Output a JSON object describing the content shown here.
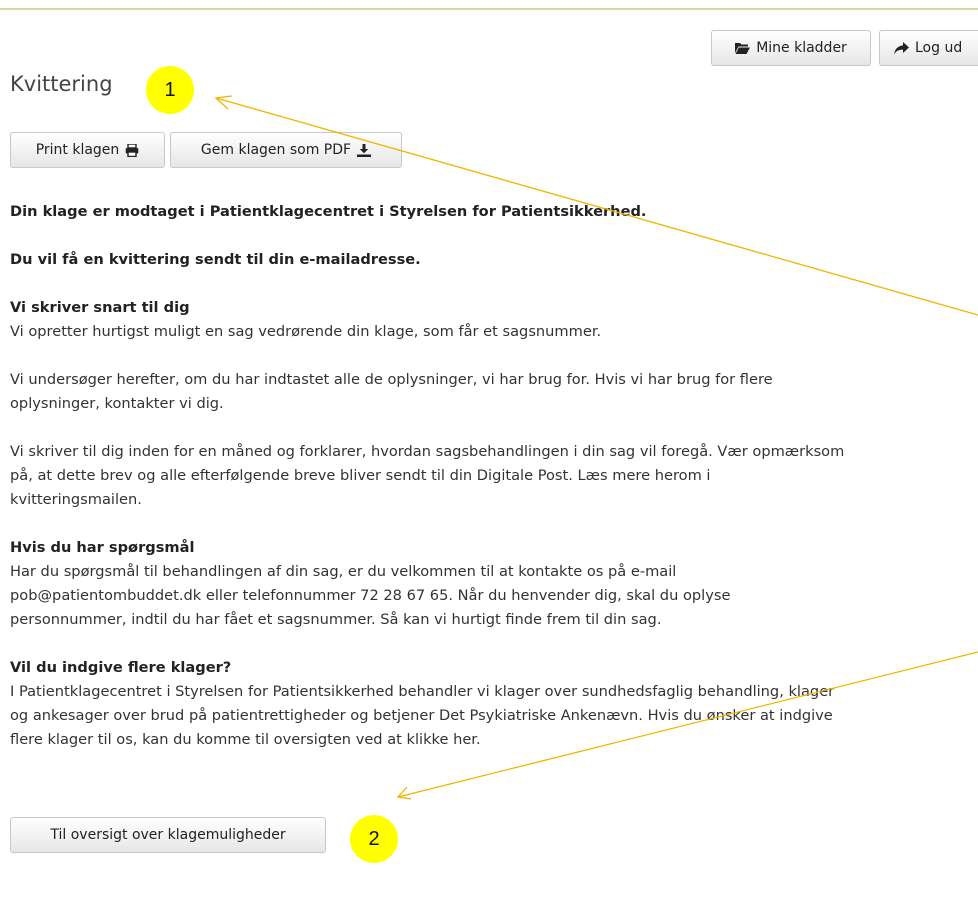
{
  "header": {
    "mine_kladder_label": "Mine kladder",
    "log_ud_label": "Log ud"
  },
  "page": {
    "title": "Kvittering"
  },
  "actions": {
    "print_label": "Print klagen",
    "pdf_label": "Gem klagen som PDF"
  },
  "content": {
    "line_received": "Din klage er modtaget i Patientklagecentret i Styrelsen for Patientsikkerhed.",
    "line_receipt": "Du vil få en kvittering sendt til din e-mailadresse.",
    "section1_heading": "Vi skriver snart til dig",
    "section1_p1": "Vi opretter hurtigst muligt en sag vedrørende din klage, som får et sagsnummer.",
    "section1_p2_l1": "Vi undersøger herefter, om du har indtastet alle de oplysninger, vi har brug for. Hvis vi har brug for flere",
    "section1_p2_l2": "oplysninger, kontakter vi dig.",
    "section1_p3_l1": "Vi skriver til dig inden for en måned og forklarer, hvordan sagsbehandlingen i din sag vil foregå. Vær opmærksom",
    "section1_p3_l2": "på, at dette brev og alle efterfølgende breve bliver sendt til din Digitale Post. Læs mere herom i",
    "section1_p3_l3": "kvitteringsmailen.",
    "section2_heading": "Hvis du har spørgsmål",
    "section2_l1": "Har du spørgsmål til behandlingen af din sag, er du velkommen til at kontakte os på e-mail",
    "section2_l2": "pob@patientombuddet.dk eller telefonnummer 72 28 67 65. Når du henvender dig, skal du oplyse",
    "section2_l3": "personnummer, indtil du har fået et sagsnummer. Så kan vi hurtigt finde frem til din sag.",
    "section3_heading": "Vil du indgive flere klager?",
    "section3_l1": "I Patientklagecentret i Styrelsen for Patientsikkerhed behandler vi klager over sundhedsfaglig behandling, klager",
    "section3_l2": "og ankesager over brud på patientrettigheder og betjener Det Psykiatriske Ankenævn. Hvis du ønsker at indgive",
    "section3_l3": "flere klager til os, kan du komme til oversigten ved at klikke her."
  },
  "footer": {
    "oversigt_label": "Til oversigt over klagemuligheder"
  },
  "annotations": {
    "badge_1": "1",
    "badge_2": "2",
    "color": "#ffff00",
    "arrow_color": "#f0b400"
  },
  "icons": {
    "mine_kladder": "folder-open-icon",
    "log_ud": "share-arrow-icon",
    "print": "print-icon",
    "pdf": "download-icon"
  }
}
